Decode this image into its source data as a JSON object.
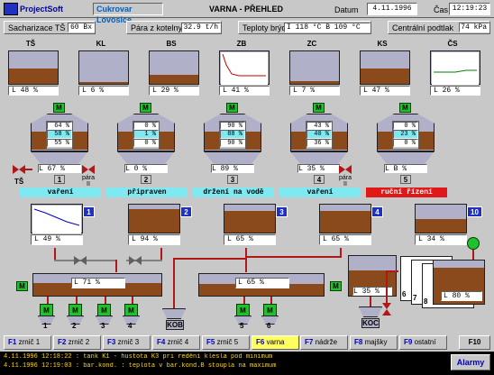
{
  "header": {
    "company": "ProjectSoft",
    "plant": "Cukrovar Lovosice",
    "title": "VARNA - PŘEHLED",
    "date_label": "Datum",
    "date": "4.11.1996",
    "time_label": "Čas",
    "time": "12:19:23"
  },
  "params": [
    {
      "label": "Sacharizace TŠ",
      "value": "60 Bx"
    },
    {
      "label": "Pára z kotelny",
      "value": "32.9 t/h"
    },
    {
      "label": "Teploty brýd",
      "value": "I  118 °C   B  109 °C"
    },
    {
      "label": "Centrální podtlak",
      "value": "74 kPa"
    }
  ],
  "top_tanks": [
    {
      "name": "TŠ",
      "level": "L   48 %"
    },
    {
      "name": "KL",
      "level": "L    6 %"
    },
    {
      "name": "BS",
      "level": "L   29 %"
    },
    {
      "name": "ZB",
      "level": "L   41 %"
    },
    {
      "name": "ZC",
      "level": "L    7 %"
    },
    {
      "name": "KS",
      "level": "L   47 %"
    },
    {
      "name": "ČS",
      "level": "L   26 %"
    }
  ],
  "pans": [
    {
      "num": "1",
      "vals": [
        "64 %",
        "58 %",
        "55 %"
      ],
      "level": "L   67 %",
      "status": "vaření",
      "motor": "M"
    },
    {
      "num": "2",
      "vals": [
        "0 %",
        "1 %",
        "0 %"
      ],
      "level": "L    0 %",
      "status": "připraven",
      "motor": "M"
    },
    {
      "num": "3",
      "vals": [
        "90 %",
        "88 %",
        "90 %"
      ],
      "level": "L   89 %",
      "status": "držení na vodě",
      "motor": "M"
    },
    {
      "num": "4",
      "vals": [
        "43 %",
        "40 %",
        "36 %"
      ],
      "level": "L   35 %",
      "status": "vaření",
      "motor": "M"
    },
    {
      "num": "5",
      "vals": [
        "0 %",
        "23 %",
        "0 %"
      ],
      "level": "L    B %",
      "status": "ruční řízení",
      "motor": "M"
    }
  ],
  "pan_labels": {
    "ts": "TŠ",
    "para1": "pára II",
    "para2": "pára II"
  },
  "mid_tanks": [
    {
      "num": "1",
      "level": "L   49 %"
    },
    {
      "num": "2",
      "level": "L   94 %"
    },
    {
      "num": "3",
      "level": "L   65 %"
    },
    {
      "num": "4",
      "level": "L   65 %"
    },
    {
      "num": "10",
      "level": "L   34 %"
    }
  ],
  "mixers": [
    {
      "level": "L   71 %"
    },
    {
      "level": "L   65 %"
    }
  ],
  "koc": {
    "level": "L   35 %",
    "label": "KOC"
  },
  "kob": "KOB",
  "stack": {
    "level": "L   80 %",
    "nums": [
      "6",
      "7",
      "8",
      "9"
    ]
  },
  "motors_left": [
    "1",
    "2",
    "3",
    "4"
  ],
  "motors_mid": [
    "5",
    "6"
  ],
  "fkeys": [
    {
      "k": "F1",
      "t": "zrnič 1"
    },
    {
      "k": "F2",
      "t": "zrnič 2"
    },
    {
      "k": "F3",
      "t": "zrnič 3"
    },
    {
      "k": "F4",
      "t": "zrnič 4"
    },
    {
      "k": "F5",
      "t": "zrnič 5"
    },
    {
      "k": "F6",
      "t": "varna"
    },
    {
      "k": "F7",
      "t": "nádrže"
    },
    {
      "k": "F8",
      "t": "majšky"
    },
    {
      "k": "F9",
      "t": "ostatní"
    }
  ],
  "alarms": [
    "4.11.1996  12:18:22 : tank K1  - hustota K3 pri redění klesla pod minimum",
    "4.11.1996  12:19:03 : bar.kond. : teplota v bar.kond.B stoupla na maximum"
  ],
  "alarm_button": "Alarmy",
  "colors": {
    "massecuite": "#8b4a1c",
    "tank": "#b0b0c8",
    "motor": "#22c02a",
    "pipe": "#b01818",
    "status_ok": "#7fe8f0",
    "status_manual": "#e01818"
  }
}
